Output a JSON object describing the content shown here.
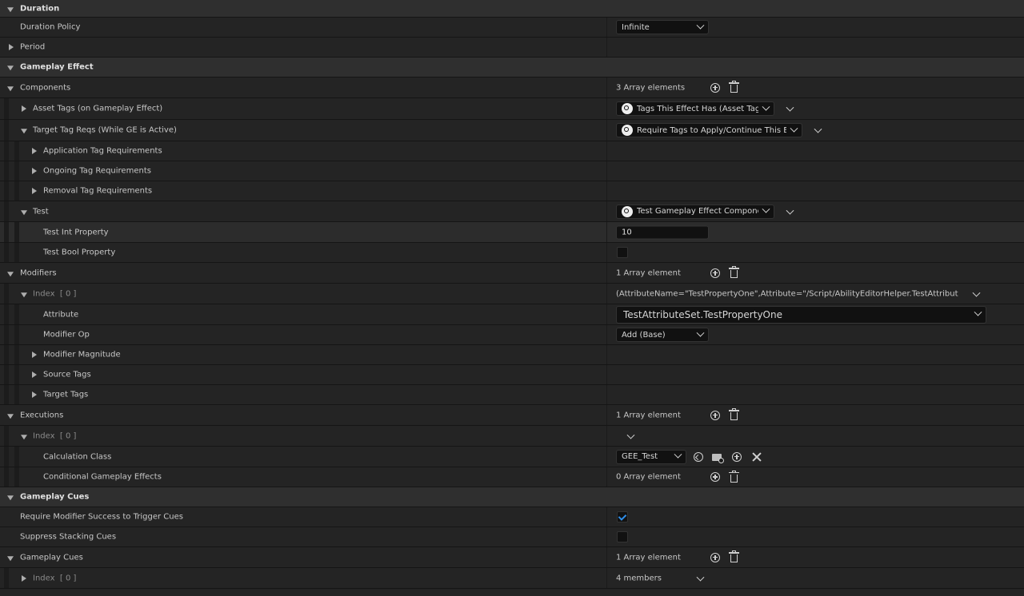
{
  "labels": {
    "duration": "Duration",
    "duration_policy": "Duration Policy",
    "period": "Period",
    "gameplay_effect": "Gameplay Effect",
    "components": "Components",
    "asset_tags": "Asset Tags (on Gameplay Effect)",
    "target_tag_reqs": "Target Tag Reqs (While GE is Active)",
    "application_tag_req": "Application Tag Requirements",
    "ongoing_tag_req": "Ongoing Tag Requirements",
    "removal_tag_req": "Removal Tag Requirements",
    "test": "Test",
    "test_int": "Test Int Property",
    "test_bool": "Test Bool Property",
    "modifiers": "Modifiers",
    "index": "Index",
    "index_num": "[ 0 ]",
    "attribute": "Attribute",
    "modifier_op": "Modifier Op",
    "modifier_magnitude": "Modifier Magnitude",
    "source_tags": "Source Tags",
    "target_tags": "Target Tags",
    "executions": "Executions",
    "calculation_class": "Calculation Class",
    "conditional_effects": "Conditional Gameplay Effects",
    "gameplay_cues_cat": "Gameplay Cues",
    "require_modifier_success": "Require Modifier Success to Trigger Cues",
    "suppress_stacking": "Suppress Stacking Cues",
    "gameplay_cues": "Gameplay Cues"
  },
  "values": {
    "duration_policy": "Infinite",
    "components_count": "3 Array elements",
    "asset_tags_combo": "Tags This Effect Has (Asset Tags)",
    "target_tag_combo": "Require Tags to Apply/Continue This Effect",
    "test_combo": "Test Gameplay Effect Component",
    "test_int": "10",
    "test_bool": false,
    "modifiers_count": "1 Array element",
    "modifier_index_summary": "(AttributeName=\"TestPropertyOne\",Attribute=\"/Script/AbilityEditorHelper.TestAttributeSet:TestPrope",
    "attribute_combo": "TestAttributeSet.TestPropertyOne",
    "modifier_op": "Add (Base)",
    "executions_count": "1 Array element",
    "calculation_class": "GEE_Test",
    "conditional_count": "0 Array element",
    "require_modifier_success": true,
    "suppress_stacking": false,
    "gameplay_cues_count": "1 Array element",
    "cue_members": "4 members"
  },
  "colors": {
    "check_accent": "#2f8ee8",
    "category_bg": "#2f2f2f",
    "row_bg": "#242424"
  }
}
